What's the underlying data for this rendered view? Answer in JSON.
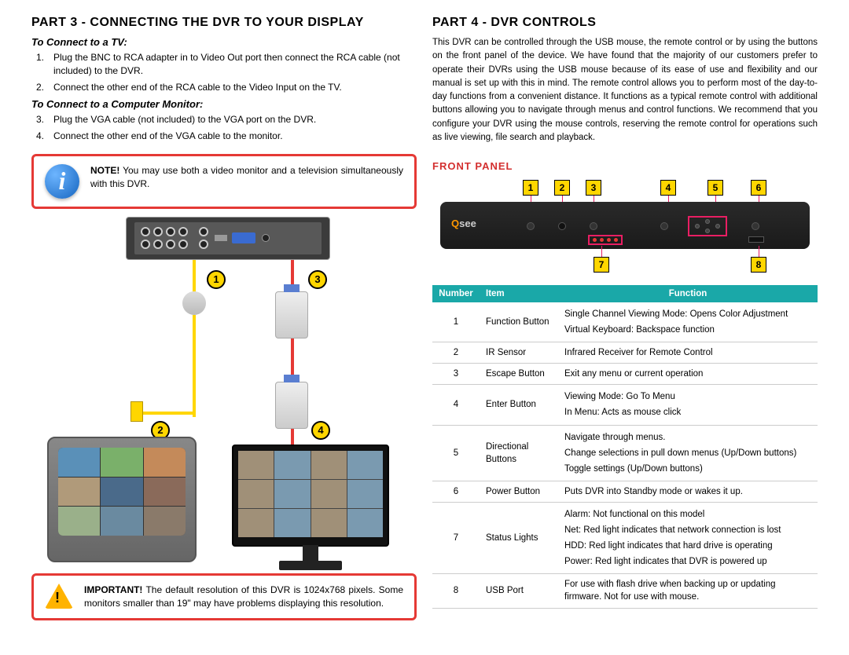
{
  "left": {
    "part_title": "PART 3 - CONNECTING THE DVR TO YOUR DISPLAY",
    "tv_title": "To Connect to a TV:",
    "tv_step1_num": "1.",
    "tv_step1": "Plug the BNC to RCA adapter in to Video Out port then connect the RCA cable (not included) to the DVR.",
    "tv_step2_num": "2.",
    "tv_step2": "Connect the other end of the RCA cable to the Video Input on the TV.",
    "mon_title": "To Connect to a Computer Monitor:",
    "mon_step3_num": "3.",
    "mon_step3": "Plug the VGA cable (not included) to the VGA port on the DVR.",
    "mon_step4_num": "4.",
    "mon_step4": "Connect the other end of the VGA cable to the monitor.",
    "note_label": "NOTE!",
    "note_text": " You may use both a video monitor and a television simultaneously with this DVR.",
    "important_label": "IMPORTANT!",
    "important_text": " The default resolution of this DVR is 1024x768 pixels. Some monitors smaller than 19\" may have problems displaying this resolution.",
    "d1": "1",
    "d2": "2",
    "d3": "3",
    "d4": "4"
  },
  "right": {
    "part_title": "PART 4 - DVR CONTROLS",
    "intro": "This DVR can be controlled through the USB mouse, the remote control or by using the buttons on the front panel of the device. We have found that the majority of our customers prefer to operate their DVRs using the USB mouse because of its ease of use and flexibility and our manual is set up with this in mind. The remote control allows you to perform most of the day-to-day functions from a convenient distance. It functions as a typical remote control with additional buttons allowing you to navigate through menus and control functions.  We recommend that you configure your DVR using the mouse controls, reserving the remote control for operations such as live viewing, file search and playback.",
    "front_panel_title": "FRONT PANEL",
    "fp": {
      "n1": "1",
      "n2": "2",
      "n3": "3",
      "n4": "4",
      "n5": "5",
      "n6": "6",
      "n7": "7",
      "n8": "8"
    },
    "th_num": "Number",
    "th_item": "Item",
    "th_fn": "Function",
    "rows": {
      "r1_num": "1",
      "r1_item": "Function Button",
      "r1_fn_a": "Single Channel Viewing Mode: Opens Color Adjustment",
      "r1_fn_b": "Virtual Keyboard: Backspace function",
      "r2_num": "2",
      "r2_item": "IR Sensor",
      "r2_fn": "Infrared Receiver for Remote Control",
      "r3_num": "3",
      "r3_item": "Escape Button",
      "r3_fn": "Exit any menu or current operation",
      "r4_num": "4",
      "r4_item": "Enter Button",
      "r4_fn_a": "Viewing Mode: Go To Menu",
      "r4_fn_b": "In Menu: Acts as mouse click",
      "r5_num": "5",
      "r5_item": "Directional Buttons",
      "r5_fn_a": "Navigate through menus.",
      "r5_fn_b": "Change selections in pull down menus (Up/Down buttons)",
      "r5_fn_c": "Toggle settings (Up/Down buttons)",
      "r6_num": "6",
      "r6_item": "Power Button",
      "r6_fn": "Puts DVR into Standby mode or wakes it up.",
      "r7_num": "7",
      "r7_item": "Status Lights",
      "r7_fn_a": "Alarm: Not functional on this model",
      "r7_fn_b": "Net: Red light indicates that network connection is lost",
      "r7_fn_c": "HDD: Red light indicates that hard drive is operating",
      "r7_fn_d": "Power: Red light indicates that DVR is powered up",
      "r8_num": "8",
      "r8_item": "USB Port",
      "r8_fn": "For use with flash drive when backing up or updating firmware. Not for use with mouse."
    }
  }
}
